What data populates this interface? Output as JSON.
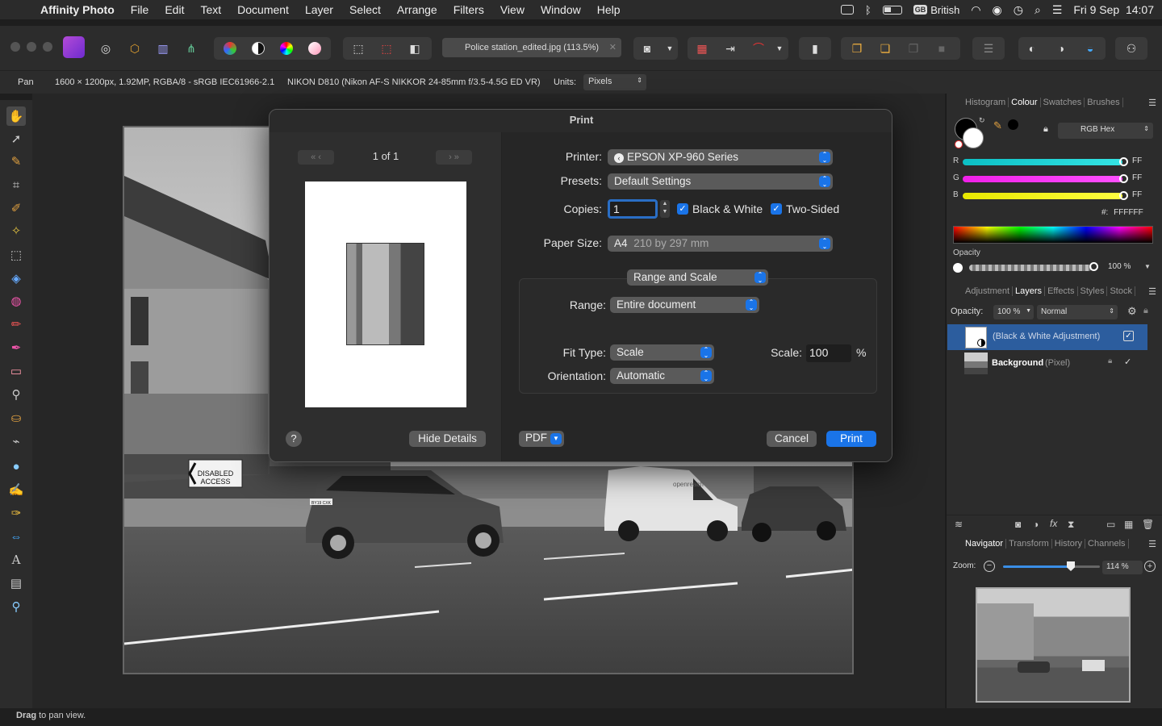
{
  "menubar": {
    "app_name": "Affinity Photo",
    "items": [
      "File",
      "Edit",
      "Text",
      "Document",
      "Layer",
      "Select",
      "Arrange",
      "Filters",
      "View",
      "Window",
      "Help"
    ],
    "input_source": "British",
    "input_badge": "GB",
    "clock": "Fri 9 Sep  14:07"
  },
  "toolbar": {
    "document_title": "Police station_edited.jpg (113.5%)",
    "close_glyph": "✕"
  },
  "context_bar": {
    "tool_name": "Pan",
    "doc_info": "1600 × 1200px, 1.92MP, RGBA/8 - sRGB IEC61966-2.1",
    "camera_info": "NIKON D810 (Nikon AF-S NIKKOR 24-85mm f/3.5-4.5G ED VR)",
    "units_label": "Units:",
    "units_value": "Pixels"
  },
  "photo": {
    "sign_text": [
      "DISABLED",
      "ACCESS"
    ],
    "plate_1": "BY19 CXK",
    "van_text": "openreach"
  },
  "status_bar": {
    "bold": "Drag",
    "rest": " to pan view."
  },
  "colour_panel": {
    "tabs": [
      "Histogram",
      "Colour",
      "Swatches",
      "Brushes"
    ],
    "active_tab": "Colour",
    "model": "RGB Hex",
    "r_label": "R",
    "r_value": "FF",
    "g_label": "G",
    "g_value": "FF",
    "b_label": "B",
    "b_value": "FF",
    "hex_label": "#:",
    "hex_value": "FFFFFF",
    "opacity_label": "Opacity",
    "opacity_value": "100 %",
    "colors": {
      "r": "#19c3c3",
      "g": "#ff20ff",
      "b": "#f0f020"
    }
  },
  "layers_panel": {
    "tabs": [
      "Adjustment",
      "Layers",
      "Effects",
      "Styles",
      "Stock"
    ],
    "active_tab": "Layers",
    "opacity_label": "Opacity:",
    "opacity_value": "100 %",
    "blend_mode": "Normal",
    "layers": [
      {
        "name": "(Black & White Adjustment)",
        "kind": "",
        "selected": true
      },
      {
        "name": "Background",
        "kind": "(Pixel)",
        "selected": false
      }
    ]
  },
  "navigator_panel": {
    "tabs": [
      "Navigator",
      "Transform",
      "History",
      "Channels"
    ],
    "active_tab": "Navigator",
    "zoom_label": "Zoom:",
    "zoom_value": "114 %"
  },
  "print_dialog": {
    "title": "Print",
    "page_indicator": "1 of 1",
    "help": "?",
    "hide_details": "Hide Details",
    "printer_label": "Printer:",
    "printer_value": "EPSON XP-960 Series",
    "presets_label": "Presets:",
    "presets_value": "Default Settings",
    "copies_label": "Copies:",
    "copies_value": "1",
    "bw_label": "Black & White",
    "two_sided_label": "Two-Sided",
    "paper_label": "Paper Size:",
    "paper_value": "A4",
    "paper_detail": "210 by 297 mm",
    "section_value": "Range and Scale",
    "range_label": "Range:",
    "range_value": "Entire document",
    "fit_label": "Fit Type:",
    "fit_value": "Scale",
    "scale_label": "Scale:",
    "scale_value": "100",
    "scale_unit": "%",
    "orientation_label": "Orientation:",
    "orientation_value": "Automatic",
    "pdf": "PDF",
    "cancel": "Cancel",
    "print": "Print"
  }
}
